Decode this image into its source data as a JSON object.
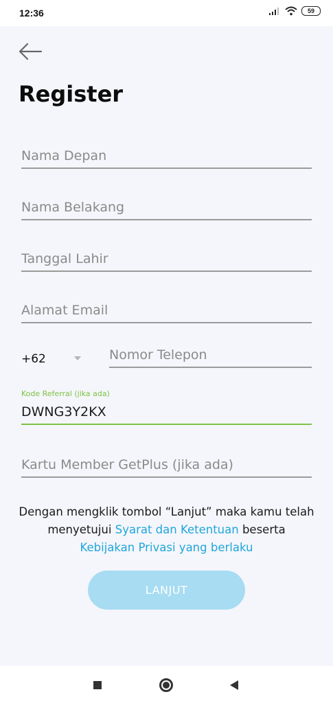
{
  "status_bar": {
    "time": "12:36",
    "battery_level": "59"
  },
  "page": {
    "title": "Register"
  },
  "form": {
    "first_name": {
      "placeholder": "Nama Depan",
      "value": ""
    },
    "last_name": {
      "placeholder": "Nama Belakang",
      "value": ""
    },
    "birth_date": {
      "placeholder": "Tanggal Lahir",
      "value": ""
    },
    "email": {
      "placeholder": "Alamat Email",
      "value": ""
    },
    "country_code": "+62",
    "phone": {
      "placeholder": "Nomor Telepon",
      "value": ""
    },
    "referral": {
      "label": "Kode Referral (jika ada)",
      "value": "DWNG3Y2KX"
    },
    "member_card": {
      "placeholder": "Kartu Member GetPlus (jika ada)",
      "value": ""
    }
  },
  "terms": {
    "prefix": "Dengan mengklik tombol “Lanjut” maka kamu telah menyetujui ",
    "terms_link": "Syarat dan Ketentuan",
    "middle": " beserta ",
    "privacy_link": "Kebijakan Privasi yang berlaku"
  },
  "submit_label": "LANJUT",
  "colors": {
    "accent_green": "#7cc242",
    "link_blue": "#1fa6db",
    "button_disabled": "#a7dcf2",
    "background": "#f5f6fb"
  },
  "icons": {
    "back": "back-arrow-icon",
    "dropdown": "chevron-down-icon",
    "signal": "signal-icon",
    "wifi": "wifi-icon",
    "battery": "battery-icon",
    "nav_recents": "recents-icon",
    "nav_home": "home-icon",
    "nav_back": "nav-back-icon"
  }
}
